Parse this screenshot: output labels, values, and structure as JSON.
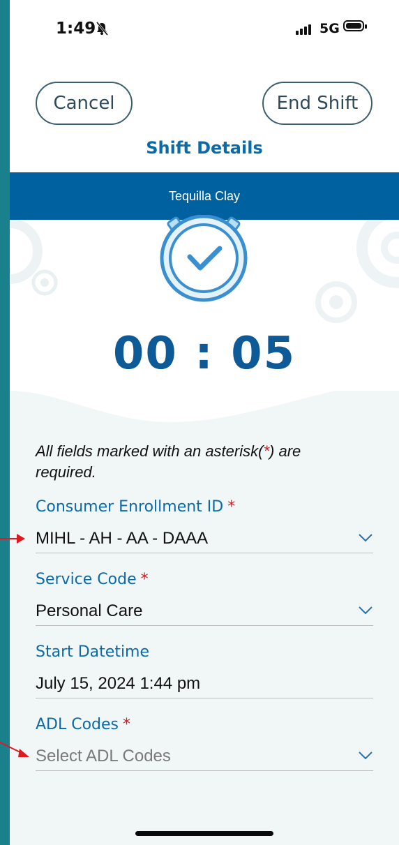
{
  "status_bar": {
    "time": "1:49",
    "network": "5G"
  },
  "header": {
    "cancel_label": "Cancel",
    "end_shift_label": "End Shift",
    "title": "Shift Details"
  },
  "band": {
    "name": "Tequilla Clay"
  },
  "timer": {
    "elapsed": "00 : 05"
  },
  "form": {
    "required_note_prefix": "All fields marked with an asterisk(",
    "required_note_asterisk": "*",
    "required_note_suffix": ") are required.",
    "fields": [
      {
        "label": "Consumer Enrollment ID",
        "required": "*",
        "value": "MIHL - AH - AA - DAAA"
      },
      {
        "label": "Service Code",
        "required": "*",
        "value": "Personal Care"
      },
      {
        "label": "Start Datetime",
        "value": "July 15, 2024 1:44 pm"
      },
      {
        "label": "ADL Codes",
        "required": "*",
        "placeholder": "Select ADL Codes"
      }
    ]
  },
  "colors": {
    "accent": "#0b6aa8",
    "band": "#0061a0",
    "timer": "#0e5a96",
    "required": "#e0191f",
    "frame": "#1a808c",
    "annotation_arrow": "#e0191f"
  }
}
